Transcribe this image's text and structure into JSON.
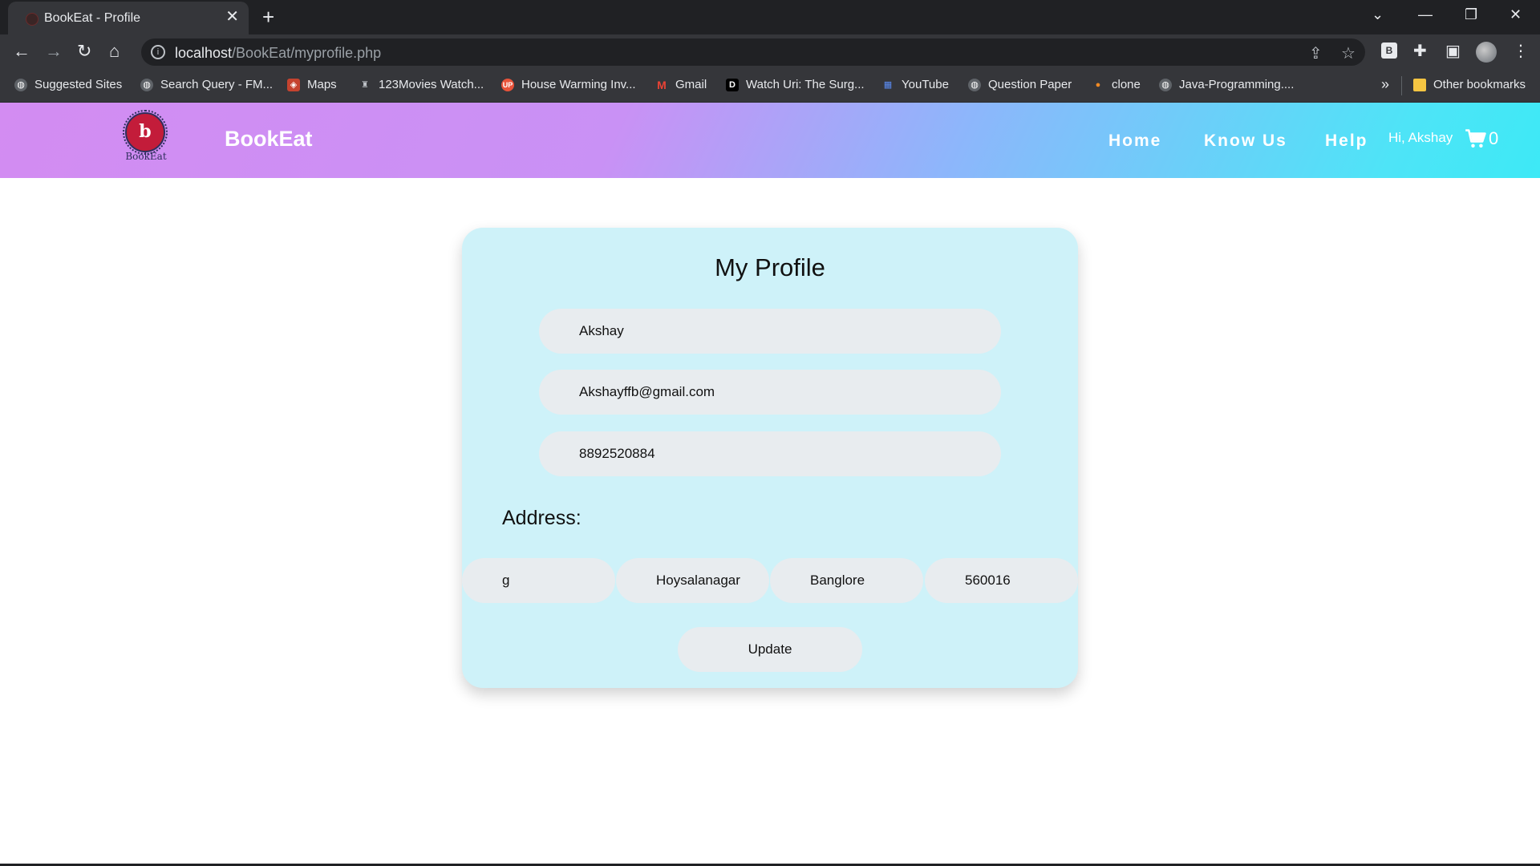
{
  "browser": {
    "tab_title": "BookEat - Profile",
    "url_host": "localhost",
    "url_path": "/BookEat/myprofile.php",
    "bookmarks": [
      {
        "label": "Suggested Sites",
        "icon": "globe-icon"
      },
      {
        "label": "Search Query - FM...",
        "icon": "globe-icon"
      },
      {
        "label": "Maps",
        "icon": "maps-icon"
      },
      {
        "label": "123Movies Watch...",
        "icon": "movie-icon"
      },
      {
        "label": "House Warming Inv...",
        "icon": "up-icon"
      },
      {
        "label": "Gmail",
        "icon": "gmail-icon"
      },
      {
        "label": "Watch Uri: The Surg...",
        "icon": "d-icon"
      },
      {
        "label": "YouTube",
        "icon": "youtube-icon"
      },
      {
        "label": "Question Paper",
        "icon": "globe-icon"
      },
      {
        "label": "clone",
        "icon": "pin-icon"
      },
      {
        "label": "Java-Programming....",
        "icon": "globe-icon"
      }
    ],
    "other_bookmarks": "Other bookmarks",
    "extension_label": "B"
  },
  "header": {
    "logo_glyph": "b",
    "logo_caption": "BookEat",
    "brand": "BookEat",
    "nav": [
      "Home",
      "Know Us",
      "Help"
    ],
    "greeting": "Hi, Akshay",
    "cart_count": "0"
  },
  "profile": {
    "title": "My Profile",
    "name": "Akshay",
    "email": "Akshayffb@gmail.com",
    "phone": "8892520884",
    "address_label": "Address:",
    "address": [
      "g",
      "Hoysalanagar",
      "Banglore",
      "560016"
    ],
    "update_label": "Update"
  },
  "colors": {
    "header_gradient_start": "#d38cf2",
    "header_gradient_end": "#3de9f6",
    "card_bg": "#cef2f9",
    "field_bg": "#e8ecef"
  }
}
